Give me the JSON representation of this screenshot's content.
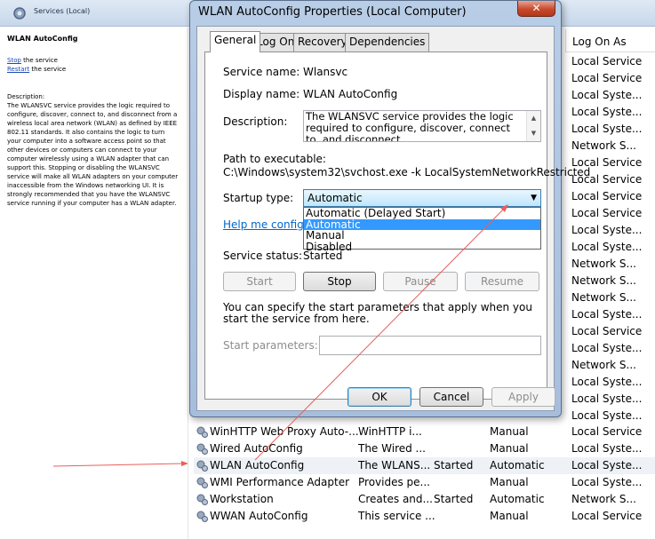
{
  "background_window": {
    "title": "Services (Local)",
    "left_pane": {
      "heading": "WLAN AutoConfig",
      "stop_link": "Stop",
      "stop_suffix": " the service",
      "restart_link": "Restart",
      "restart_suffix": " the service",
      "description_label": "Description:",
      "description": "The WLANSVC service provides the logic required to configure, discover, connect to, and disconnect from a wireless local area network (WLAN) as defined by IEEE 802.11 standards. It also contains the logic to turn your computer into a software access point so that other devices or computers can connect to your computer wirelessly using a WLAN adapter that can support this. Stopping or disabling the WLANSVC service will make all WLAN adapters on your computer inaccessible from the Windows networking UI. It is strongly recommended that you have the WLANSVC service running if your computer has a WLAN adapter."
    },
    "log_on_as_header": "Log On As",
    "log_on_as_visible": [
      "Local Service",
      "Local Service",
      "Local Syste...",
      "Local Syste...",
      "Local Syste...",
      "Network S...",
      "Local Service",
      "Local Service",
      "Local Service",
      "Local Service",
      "Local Syste...",
      "Local Syste...",
      "Network S...",
      "Network S...",
      "Network S...",
      "Local Syste...",
      "Local Service",
      "Local Syste...",
      "Network S...",
      "Local Syste...",
      "Local Syste...",
      "Local Syste..."
    ],
    "services": [
      {
        "name": "WinHTTP Web Proxy Auto-...",
        "description": "WinHTTP i...",
        "status": "",
        "startup": "Manual",
        "logon": "Local Service",
        "selected": false
      },
      {
        "name": "Wired AutoConfig",
        "description": "The Wired ...",
        "status": "",
        "startup": "Manual",
        "logon": "Local Syste...",
        "selected": false
      },
      {
        "name": "WLAN AutoConfig",
        "description": "The WLANS...",
        "status": "Started",
        "startup": "Automatic",
        "logon": "Local Syste...",
        "selected": true
      },
      {
        "name": "WMI Performance Adapter",
        "description": "Provides pe...",
        "status": "",
        "startup": "Manual",
        "logon": "Local Syste...",
        "selected": false
      },
      {
        "name": "Workstation",
        "description": "Creates and...",
        "status": "Started",
        "startup": "Automatic",
        "logon": "Network S...",
        "selected": false
      },
      {
        "name": "WWAN AutoConfig",
        "description": "This service ...",
        "status": "",
        "startup": "Manual",
        "logon": "Local Service",
        "selected": false
      }
    ]
  },
  "dialog": {
    "title": "WLAN AutoConfig Properties (Local Computer)",
    "close_glyph": "✕",
    "tabs": [
      "General",
      "Log On",
      "Recovery",
      "Dependencies"
    ],
    "active_tab": "General",
    "service_name_label": "Service name:",
    "service_name": "Wlansvc",
    "display_name_label": "Display name:",
    "display_name": "WLAN AutoConfig",
    "description_label": "Description:",
    "description": "The WLANSVC service provides the logic required to configure, discover, connect to, and disconnect",
    "path_label": "Path to executable:",
    "path": "C:\\Windows\\system32\\svchost.exe -k LocalSystemNetworkRestricted",
    "startup_type_label": "Startup type:",
    "startup_type_value": "Automatic",
    "startup_options": [
      "Automatic (Delayed Start)",
      "Automatic",
      "Manual",
      "Disabled"
    ],
    "startup_highlighted": "Automatic",
    "help_link": "Help me configure s",
    "service_status_label": "Service status:",
    "service_status": "Started",
    "buttons": {
      "start": "Start",
      "stop": "Stop",
      "pause": "Pause",
      "resume": "Resume"
    },
    "start_params_note": "You can specify the start parameters that apply when you start the service from here.",
    "start_params_label": "Start parameters:",
    "start_params_value": "",
    "footer": {
      "ok": "OK",
      "cancel": "Cancel",
      "apply": "Apply"
    }
  },
  "colors": {
    "annotation_arrow": "#e8605a",
    "selection": "#3399ff",
    "link": "#0066cc"
  }
}
